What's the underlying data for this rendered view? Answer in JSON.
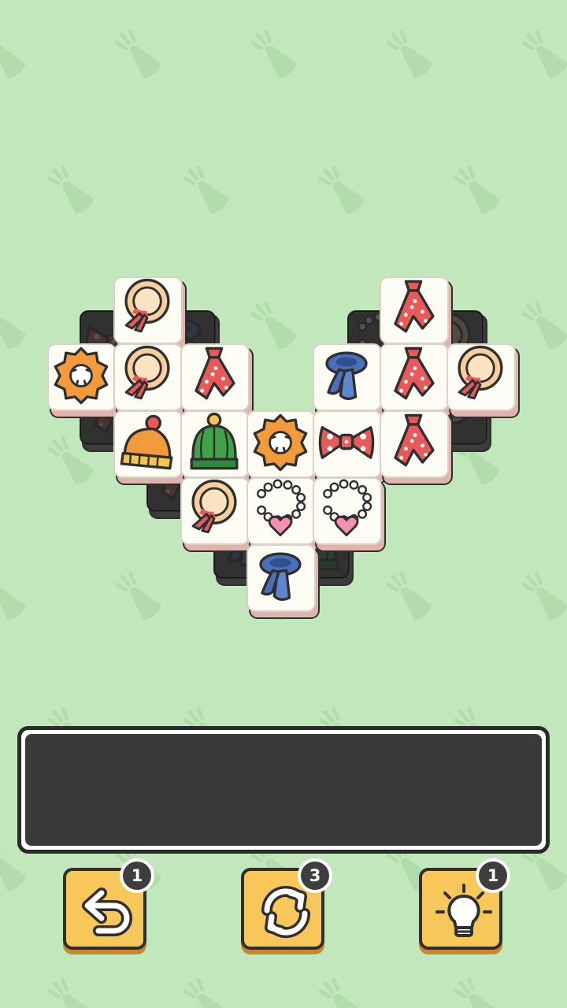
{
  "colors": {
    "background": "#c3e7bd",
    "tile_face": "#fcfcf5",
    "tile_side": "#e0b3ad",
    "tray_fill": "#3a3a3a",
    "button_fill": "#f8c75a"
  },
  "board": {
    "top_tiles": [
      {
        "icon": "straw-hat-icon"
      },
      {
        "icon": "polka-tie-icon"
      },
      {
        "icon": "flower-scrunchie-icon"
      },
      {
        "icon": "straw-hat-icon"
      },
      {
        "icon": "polka-tie-icon"
      },
      {
        "icon": "blue-scarf-icon"
      },
      {
        "icon": "polka-tie-icon"
      },
      {
        "icon": "straw-hat-icon"
      },
      {
        "icon": "orange-beanie-icon"
      },
      {
        "icon": "green-beanie-icon"
      },
      {
        "icon": "flower-scrunchie-icon"
      },
      {
        "icon": "bow-tie-icon"
      },
      {
        "icon": "polka-tie-icon"
      },
      {
        "icon": "straw-hat-icon"
      },
      {
        "icon": "pearl-necklace-icon"
      },
      {
        "icon": "pearl-necklace-icon"
      },
      {
        "icon": "blue-scarf-icon"
      }
    ],
    "covered_tiles_count": 10
  },
  "tray": {
    "slots": 7
  },
  "buttons": {
    "undo": {
      "icon": "undo-arrow-icon",
      "count": "1"
    },
    "shuffle": {
      "icon": "shuffle-icon",
      "count": "3"
    },
    "hint": {
      "icon": "lightbulb-icon",
      "count": "1"
    }
  }
}
